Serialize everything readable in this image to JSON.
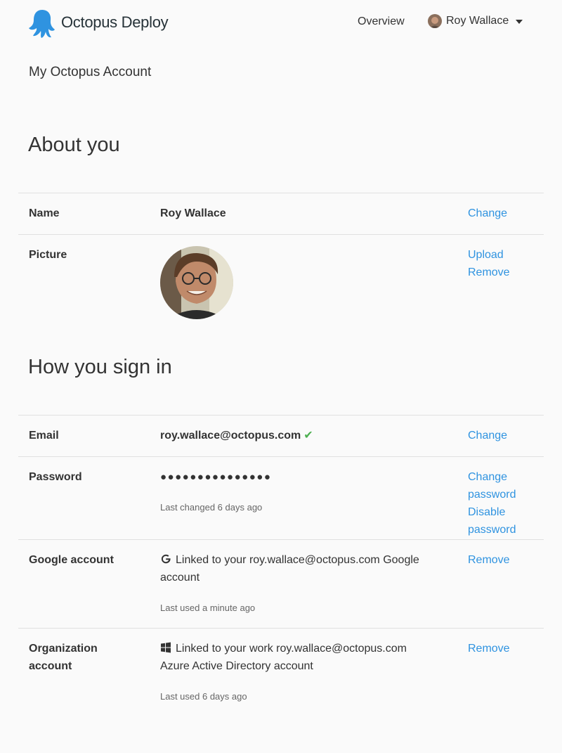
{
  "header": {
    "brand": "Octopus Deploy",
    "nav_overview": "Overview",
    "user_name": "Roy Wallace"
  },
  "page": {
    "title": "My Octopus Account"
  },
  "about": {
    "title": "About you",
    "name_label": "Name",
    "name_value": "Roy Wallace",
    "name_action": "Change",
    "picture_label": "Picture",
    "picture_upload": "Upload",
    "picture_remove": "Remove"
  },
  "signin": {
    "title": "How you sign in",
    "email_label": "Email",
    "email_value": "roy.wallace@octopus.com",
    "email_action": "Change",
    "password_label": "Password",
    "password_value": "●●●●●●●●●●●●●●●",
    "password_changed": "Last changed 6 days ago",
    "password_change_action_1": "Change",
    "password_change_action_2": "password",
    "password_disable_action_1": "Disable",
    "password_disable_action_2": "password",
    "google_label": "Google account",
    "google_line1": "Linked to your roy.wallace@octopus.com Google",
    "google_line2": "account",
    "google_used": "Last used a minute ago",
    "google_action": "Remove",
    "org_label_1": "Organization",
    "org_label_2": "account",
    "org_line1": "Linked to your work roy.wallace@octopus.com",
    "org_line2": "Azure Active Directory account",
    "org_used": "Last used 6 days ago",
    "org_action": "Remove"
  },
  "colors": {
    "link": "#2f93e0",
    "brand_blue": "#2f93e0",
    "check": "#4caf50"
  },
  "icons": [
    "octopus-logo",
    "user-avatar",
    "caret-down-icon",
    "check-icon",
    "google-icon",
    "windows-icon"
  ]
}
